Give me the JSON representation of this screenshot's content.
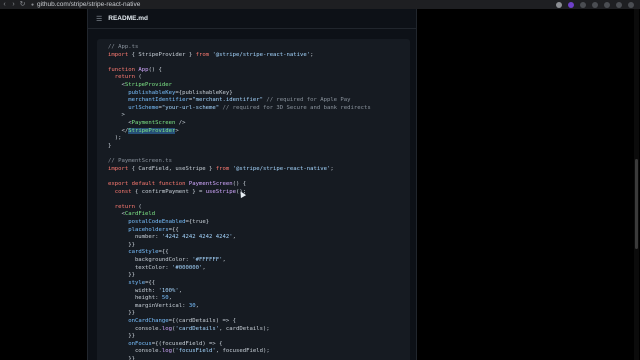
{
  "browser": {
    "url": "github.com/stripe/stripe-react-native"
  },
  "readme": {
    "title": "README.md"
  },
  "code_lines": [
    [
      {
        "t": "// App.ts",
        "c": "c-com"
      }
    ],
    [
      {
        "t": "import",
        "c": "c-kw"
      },
      {
        "t": " { StripeProvider } ",
        "c": ""
      },
      {
        "t": "from",
        "c": "c-kw"
      },
      {
        "t": " ",
        "c": ""
      },
      {
        "t": "'@stripe/stripe-react-native'",
        "c": "c-str"
      },
      {
        "t": ";",
        "c": ""
      }
    ],
    [
      {
        "t": "",
        "c": ""
      }
    ],
    [
      {
        "t": "function",
        "c": "c-kw"
      },
      {
        "t": " ",
        "c": ""
      },
      {
        "t": "App",
        "c": "c-fn"
      },
      {
        "t": "() {",
        "c": ""
      }
    ],
    [
      {
        "t": "  ",
        "c": ""
      },
      {
        "t": "return",
        "c": "c-kw"
      },
      {
        "t": " (",
        "c": ""
      }
    ],
    [
      {
        "t": "    <",
        "c": ""
      },
      {
        "t": "StripeProvider",
        "c": "c-tag"
      }
    ],
    [
      {
        "t": "      ",
        "c": ""
      },
      {
        "t": "publishableKey",
        "c": "c-attr"
      },
      {
        "t": "={publishableKey}",
        "c": ""
      }
    ],
    [
      {
        "t": "      ",
        "c": ""
      },
      {
        "t": "merchantIdentifier",
        "c": "c-attr"
      },
      {
        "t": "=",
        "c": ""
      },
      {
        "t": "\"merchant.identifier\"",
        "c": "c-str"
      },
      {
        "t": " ",
        "c": ""
      },
      {
        "t": "// required for Apple Pay",
        "c": "c-com"
      }
    ],
    [
      {
        "t": "      ",
        "c": ""
      },
      {
        "t": "urlScheme",
        "c": "c-attr"
      },
      {
        "t": "=",
        "c": ""
      },
      {
        "t": "\"your-url-scheme\"",
        "c": "c-str"
      },
      {
        "t": " ",
        "c": ""
      },
      {
        "t": "// required for 3D Secure and bank redirects",
        "c": "c-com"
      }
    ],
    [
      {
        "t": "    >",
        "c": ""
      }
    ],
    [
      {
        "t": "      <",
        "c": ""
      },
      {
        "t": "PaymentScreen",
        "c": "c-tag"
      },
      {
        "t": " />",
        "c": ""
      }
    ],
    [
      {
        "t": "    </",
        "c": ""
      },
      {
        "t": "StripeProvider",
        "c": "c-tag c-sel"
      },
      {
        "t": ">",
        "c": ""
      }
    ],
    [
      {
        "t": "  );",
        "c": ""
      }
    ],
    [
      {
        "t": "}",
        "c": ""
      }
    ],
    [
      {
        "t": "",
        "c": ""
      }
    ],
    [
      {
        "t": "// PaymentScreen.ts",
        "c": "c-com"
      }
    ],
    [
      {
        "t": "import",
        "c": "c-kw"
      },
      {
        "t": " { CardField, useStripe } ",
        "c": ""
      },
      {
        "t": "from",
        "c": "c-kw"
      },
      {
        "t": " ",
        "c": ""
      },
      {
        "t": "'@stripe/stripe-react-native'",
        "c": "c-str"
      },
      {
        "t": ";",
        "c": ""
      }
    ],
    [
      {
        "t": "",
        "c": ""
      }
    ],
    [
      {
        "t": "export",
        "c": "c-kw"
      },
      {
        "t": " ",
        "c": ""
      },
      {
        "t": "default",
        "c": "c-kw"
      },
      {
        "t": " ",
        "c": ""
      },
      {
        "t": "function",
        "c": "c-kw"
      },
      {
        "t": " ",
        "c": ""
      },
      {
        "t": "PaymentScreen",
        "c": "c-fn"
      },
      {
        "t": "() {",
        "c": ""
      }
    ],
    [
      {
        "t": "  ",
        "c": ""
      },
      {
        "t": "const",
        "c": "c-kw"
      },
      {
        "t": " { confirmPayment } = ",
        "c": ""
      },
      {
        "t": "useStripe",
        "c": "c-fn"
      },
      {
        "t": "();",
        "c": ""
      }
    ],
    [
      {
        "t": "",
        "c": ""
      }
    ],
    [
      {
        "t": "  ",
        "c": ""
      },
      {
        "t": "return",
        "c": "c-kw"
      },
      {
        "t": " (",
        "c": ""
      }
    ],
    [
      {
        "t": "    <",
        "c": ""
      },
      {
        "t": "CardField",
        "c": "c-tag"
      }
    ],
    [
      {
        "t": "      ",
        "c": ""
      },
      {
        "t": "postalCodeEnabled",
        "c": "c-attr"
      },
      {
        "t": "={true}",
        "c": ""
      }
    ],
    [
      {
        "t": "      ",
        "c": ""
      },
      {
        "t": "placeholders",
        "c": "c-attr"
      },
      {
        "t": "={{",
        "c": ""
      }
    ],
    [
      {
        "t": "        number: ",
        "c": ""
      },
      {
        "t": "'4242 4242 4242 4242'",
        "c": "c-str"
      },
      {
        "t": ",",
        "c": ""
      }
    ],
    [
      {
        "t": "      }}",
        "c": ""
      }
    ],
    [
      {
        "t": "      ",
        "c": ""
      },
      {
        "t": "cardStyle",
        "c": "c-attr"
      },
      {
        "t": "={{",
        "c": ""
      }
    ],
    [
      {
        "t": "        backgroundColor: ",
        "c": ""
      },
      {
        "t": "'#FFFFFF'",
        "c": "c-str"
      },
      {
        "t": ",",
        "c": ""
      }
    ],
    [
      {
        "t": "        textColor: ",
        "c": ""
      },
      {
        "t": "'#000000'",
        "c": "c-str"
      },
      {
        "t": ",",
        "c": ""
      }
    ],
    [
      {
        "t": "      }}",
        "c": ""
      }
    ],
    [
      {
        "t": "      ",
        "c": ""
      },
      {
        "t": "style",
        "c": "c-attr"
      },
      {
        "t": "={{",
        "c": ""
      }
    ],
    [
      {
        "t": "        width: ",
        "c": ""
      },
      {
        "t": "'100%'",
        "c": "c-str"
      },
      {
        "t": ",",
        "c": ""
      }
    ],
    [
      {
        "t": "        height: ",
        "c": ""
      },
      {
        "t": "50",
        "c": "c-attr"
      },
      {
        "t": ",",
        "c": ""
      }
    ],
    [
      {
        "t": "        marginVertical: ",
        "c": ""
      },
      {
        "t": "30",
        "c": "c-attr"
      },
      {
        "t": ",",
        "c": ""
      }
    ],
    [
      {
        "t": "      }}",
        "c": ""
      }
    ],
    [
      {
        "t": "      ",
        "c": ""
      },
      {
        "t": "onCardChange",
        "c": "c-attr"
      },
      {
        "t": "={(cardDetails) => {",
        "c": ""
      }
    ],
    [
      {
        "t": "        console.",
        "c": ""
      },
      {
        "t": "log",
        "c": "c-fn"
      },
      {
        "t": "(",
        "c": ""
      },
      {
        "t": "'cardDetails'",
        "c": "c-str"
      },
      {
        "t": ", cardDetails);",
        "c": ""
      }
    ],
    [
      {
        "t": "      }}",
        "c": ""
      }
    ],
    [
      {
        "t": "      ",
        "c": ""
      },
      {
        "t": "onFocus",
        "c": "c-attr"
      },
      {
        "t": "={(focusedField) => {",
        "c": ""
      }
    ],
    [
      {
        "t": "        console.",
        "c": ""
      },
      {
        "t": "log",
        "c": "c-fn"
      },
      {
        "t": "(",
        "c": ""
      },
      {
        "t": "'focusField'",
        "c": "c-str"
      },
      {
        "t": ", focusedField);",
        "c": ""
      }
    ],
    [
      {
        "t": "      }}",
        "c": ""
      }
    ]
  ],
  "icons": {
    "back": "arrow-left-icon",
    "lock": "lock-icon"
  }
}
